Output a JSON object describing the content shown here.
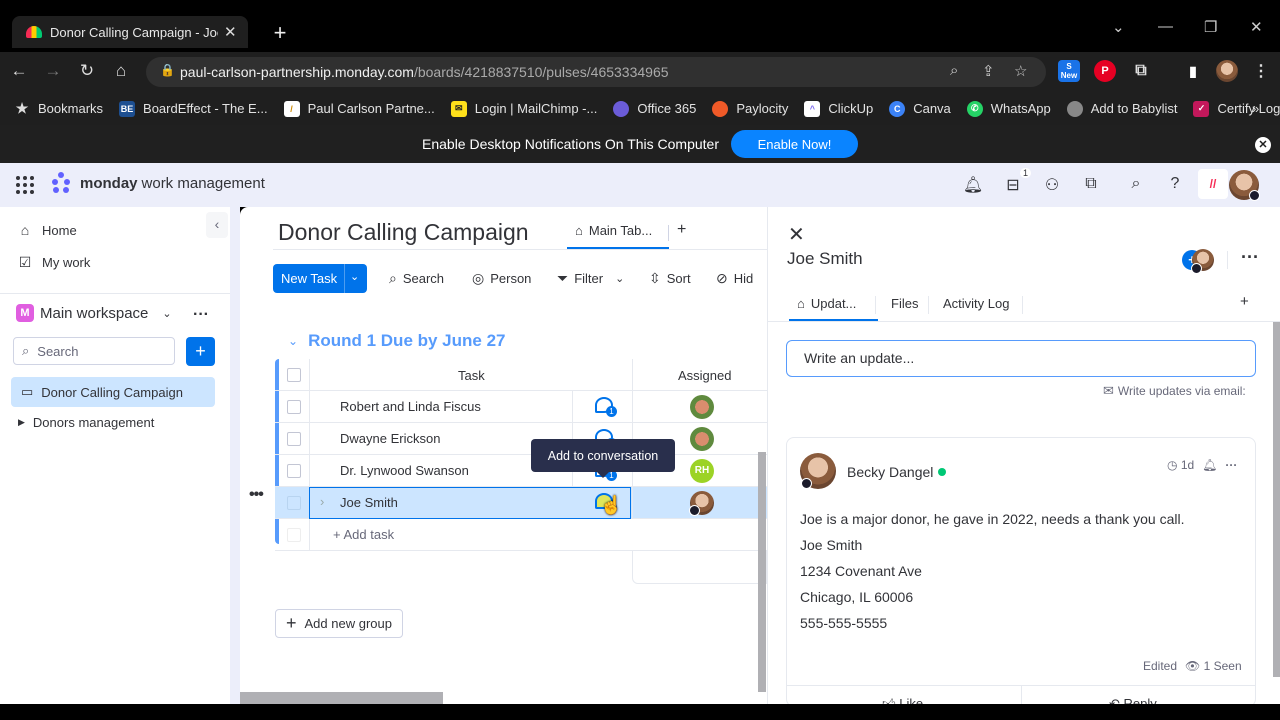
{
  "browser": {
    "tab_title": "Donor Calling Campaign - Joe Smith",
    "url_host": "paul-carlson-partnership.monday.com",
    "url_path": "/boards/4218837510/pulses/4653334965",
    "bookmarks": [
      {
        "label": "Bookmarks",
        "icon": "star-icon"
      },
      {
        "label": "BoardEffect - The E...",
        "icon": "boardeffect-icon"
      },
      {
        "label": "Paul Carlson Partne...",
        "icon": "paul-carlson-icon"
      },
      {
        "label": "Login | MailChimp -...",
        "icon": "mailchimp-icon"
      },
      {
        "label": "Office 365",
        "icon": "office-icon"
      },
      {
        "label": "Paylocity",
        "icon": "paylocity-icon"
      },
      {
        "label": "ClickUp",
        "icon": "clickup-icon"
      },
      {
        "label": "Canva",
        "icon": "canva-icon"
      },
      {
        "label": "WhatsApp",
        "icon": "whatsapp-icon"
      },
      {
        "label": "Add to Babylist",
        "icon": "globe-icon"
      },
      {
        "label": "Certify Login",
        "icon": "certify-icon"
      }
    ],
    "ext_new_label": "New",
    "more_bookmarks": "»"
  },
  "banner": {
    "message": "Enable Desktop Notifications On This Computer",
    "button": "Enable Now!"
  },
  "app": {
    "brand_bold": "monday",
    "brand_rest": "work management",
    "inbox_count": "1"
  },
  "sidebar": {
    "home": "Home",
    "my_work": "My work",
    "workspace_initial": "M",
    "workspace": "Main workspace",
    "search_placeholder": "Search",
    "boards": [
      {
        "label": "Donor Calling Campaign",
        "selected": true
      },
      {
        "label": "Donors management",
        "selected": false
      }
    ]
  },
  "board": {
    "title": "Donor Calling Campaign",
    "view_tab": "Main Tab...",
    "new_task": "New Task",
    "toolbar": [
      "Search",
      "Person",
      "Filter",
      "Sort",
      "Hid"
    ],
    "group_title": "Round 1 Due by June 27",
    "group_color": "#579bfc",
    "columns": [
      "Task",
      "Assigned"
    ],
    "rows": [
      {
        "name": "Robert and Linda Fiscus",
        "updates": "1",
        "assigned": "avatar-photo"
      },
      {
        "name": "Dwayne Erickson",
        "updates": "1",
        "assigned": "avatar-photo"
      },
      {
        "name": "Dr. Lynwood Swanson",
        "updates": "1",
        "assigned": "RH"
      },
      {
        "name": "Joe Smith",
        "updates": "1",
        "assigned": "avatar-photo",
        "selected": true
      }
    ],
    "add_task": "+ Add task",
    "tooltip": "Add to conversation",
    "add_group": "Add new group"
  },
  "panel": {
    "title": "Joe Smith",
    "tabs": [
      "Updat...",
      "Files",
      "Activity Log"
    ],
    "write_placeholder": "Write an update...",
    "email_hint": "Write updates via email:",
    "post": {
      "author": "Becky Dangel",
      "time": "1d",
      "lines": [
        "Joe is a major donor, he gave in 2022, needs a thank you call.",
        "Joe Smith",
        "1234 Covenant Ave",
        "Chicago, IL 60006",
        "555-555-5555"
      ],
      "edited": "Edited",
      "seen": "1 Seen",
      "like": "Like",
      "reply": "Reply"
    }
  }
}
